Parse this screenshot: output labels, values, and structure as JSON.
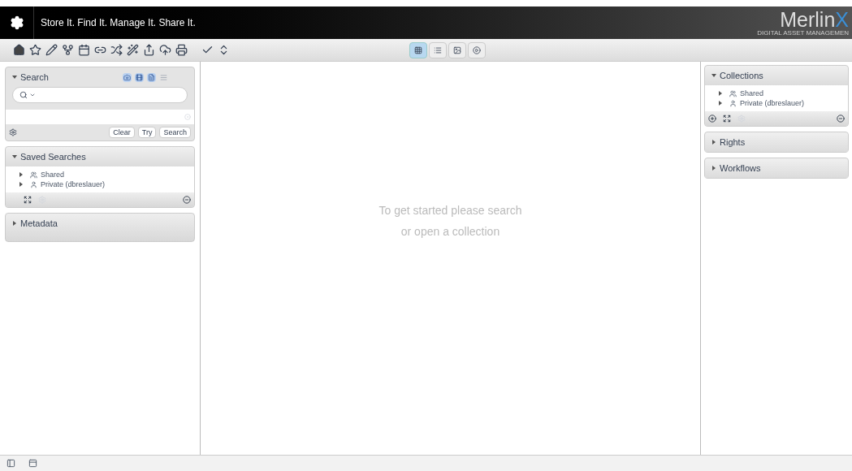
{
  "header": {
    "tagline": "Store It. Find It. Manage It. Share It.",
    "logo": {
      "name": "Merlin",
      "mark": "X",
      "subtitle": "DIGITAL ASSET MANAGEMEN"
    }
  },
  "view_modes": [
    {
      "kind": "grid",
      "selected": true
    },
    {
      "kind": "list",
      "selected": false
    },
    {
      "kind": "image",
      "selected": false
    },
    {
      "kind": "video",
      "selected": false
    }
  ],
  "search_panel": {
    "title": "Search",
    "expanded": true,
    "types": [
      {
        "kind": "photo",
        "selected": true
      },
      {
        "kind": "film",
        "selected": true
      },
      {
        "kind": "document",
        "selected": true
      },
      {
        "kind": "text",
        "selected": false
      }
    ],
    "buttons": [
      "Clear",
      "Try",
      "Search"
    ]
  },
  "saved_searches": {
    "title": "Saved Searches",
    "expanded": true,
    "items": [
      {
        "kind": "group",
        "label": "Shared"
      },
      {
        "kind": "user",
        "label": "Private (dbreslauer)"
      }
    ]
  },
  "metadata": {
    "title": "Metadata",
    "expanded": false
  },
  "message": [
    "To get started please search",
    "or open a collection"
  ],
  "right_panels": [
    {
      "title": "Collections",
      "expanded": true,
      "items": [
        {
          "kind": "group",
          "label": "Shared"
        },
        {
          "kind": "user",
          "label": "Private (dbreslauer)"
        }
      ]
    },
    {
      "title": "Rights",
      "expanded": false
    },
    {
      "title": "Workflows",
      "expanded": false
    }
  ]
}
